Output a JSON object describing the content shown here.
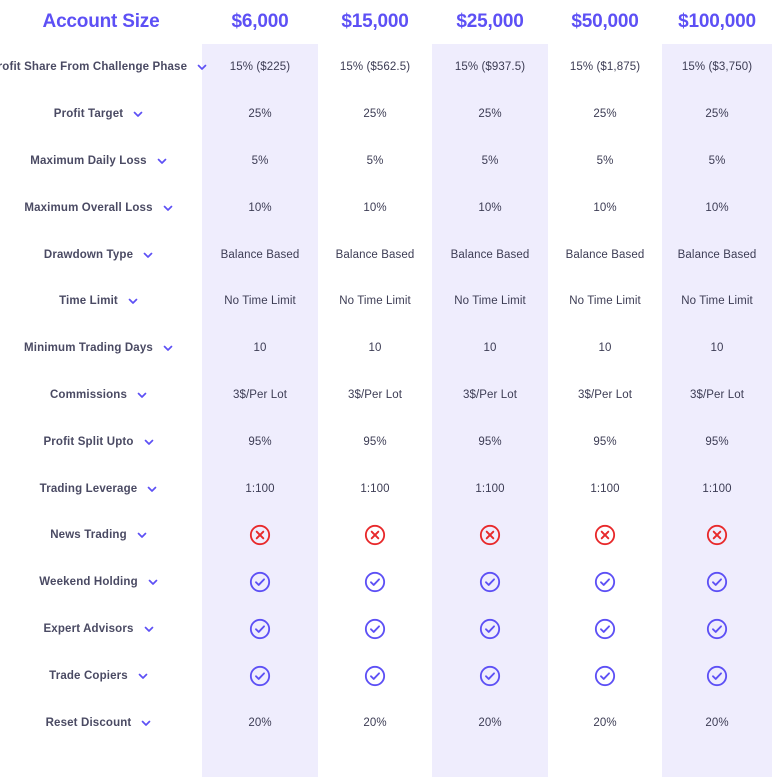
{
  "theme": {
    "accent": "#5D50F5",
    "stripe_bg": "#EFEDFD",
    "label_text": "#4A4A63",
    "value_text": "#3C3C54",
    "yes_color": "#5D50F5",
    "no_color": "#E8292B",
    "page_bg": "#FFFFFF"
  },
  "header": {
    "row_label": "Account Size",
    "columns": [
      "$6,000",
      "$15,000",
      "$25,000",
      "$50,000",
      "$100,000"
    ]
  },
  "icons": {
    "chevron": "chevron-down-icon",
    "yes": "circle-check-icon",
    "no": "circle-x-icon"
  },
  "rows": [
    {
      "label": "Profit Share From Challenge Phase",
      "values": [
        "15% ($225)",
        "15% ($562.5)",
        "15% ($937.5)",
        "15% ($1,875)",
        "15% ($3,750)"
      ],
      "type": "text"
    },
    {
      "label": "Profit Target",
      "values": [
        "25%",
        "25%",
        "25%",
        "25%",
        "25%"
      ],
      "type": "text"
    },
    {
      "label": "Maximum Daily Loss",
      "values": [
        "5%",
        "5%",
        "5%",
        "5%",
        "5%"
      ],
      "type": "text"
    },
    {
      "label": "Maximum Overall Loss",
      "values": [
        "10%",
        "10%",
        "10%",
        "10%",
        "10%"
      ],
      "type": "text"
    },
    {
      "label": "Drawdown Type",
      "values": [
        "Balance Based",
        "Balance Based",
        "Balance Based",
        "Balance Based",
        "Balance Based"
      ],
      "type": "text"
    },
    {
      "label": "Time Limit",
      "values": [
        "No Time Limit",
        "No Time Limit",
        "No Time Limit",
        "No Time Limit",
        "No Time Limit"
      ],
      "type": "text"
    },
    {
      "label": "Minimum Trading Days",
      "values": [
        "10",
        "10",
        "10",
        "10",
        "10"
      ],
      "type": "text"
    },
    {
      "label": "Commissions",
      "values": [
        "3$/Per Lot",
        "3$/Per Lot",
        "3$/Per Lot",
        "3$/Per Lot",
        "3$/Per Lot"
      ],
      "type": "text"
    },
    {
      "label": "Profit Split Upto",
      "values": [
        "95%",
        "95%",
        "95%",
        "95%",
        "95%"
      ],
      "type": "text"
    },
    {
      "label": "Trading Leverage",
      "values": [
        "1:100",
        "1:100",
        "1:100",
        "1:100",
        "1:100"
      ],
      "type": "text"
    },
    {
      "label": "News Trading",
      "values": [
        "no",
        "no",
        "no",
        "no",
        "no"
      ],
      "type": "icon"
    },
    {
      "label": "Weekend Holding",
      "values": [
        "yes",
        "yes",
        "yes",
        "yes",
        "yes"
      ],
      "type": "icon"
    },
    {
      "label": "Expert Advisors",
      "values": [
        "yes",
        "yes",
        "yes",
        "yes",
        "yes"
      ],
      "type": "icon"
    },
    {
      "label": "Trade Copiers",
      "values": [
        "yes",
        "yes",
        "yes",
        "yes",
        "yes"
      ],
      "type": "icon"
    },
    {
      "label": "Reset Discount",
      "values": [
        "20%",
        "20%",
        "20%",
        "20%",
        "20%"
      ],
      "type": "text"
    }
  ]
}
